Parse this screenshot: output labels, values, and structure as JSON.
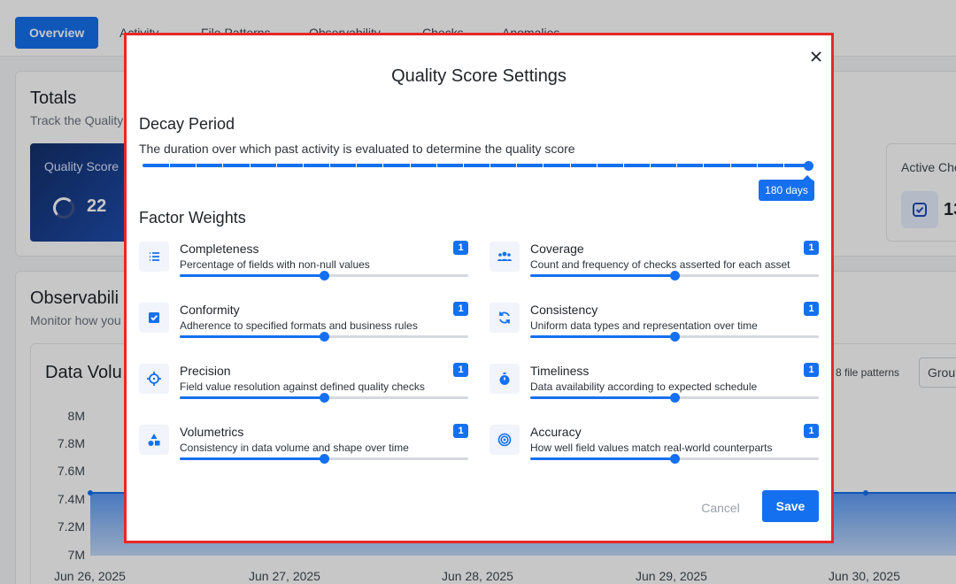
{
  "background": {
    "tabs": [
      {
        "label": "Overview",
        "active": true
      },
      {
        "label": "Activity"
      },
      {
        "label": "File Patterns"
      },
      {
        "label": "Observability"
      },
      {
        "label": "Checks"
      },
      {
        "label": "Anomalies"
      }
    ],
    "totals": {
      "title": "Totals",
      "subtitle": "Track the Quality",
      "quality_score_label": "Quality Score",
      "quality_score_value": "22",
      "active_checks_label": "Active Che",
      "active_checks_value": "13"
    },
    "observability": {
      "title": "Observabili",
      "subtitle": "Monitor how you"
    },
    "data_volume": {
      "title": "Data Volu",
      "file_patterns": "8 file patterns",
      "group_button": "Grou"
    },
    "chart_data": {
      "type": "area",
      "y_ticks": [
        "8M",
        "7.8M",
        "7.6M",
        "7.4M",
        "7.2M",
        "7M"
      ],
      "x_ticks": [
        "Jun 26, 2025",
        "Jun 27, 2025",
        "Jun 28, 2025",
        "Jun 29, 2025",
        "Jun 30, 2025"
      ],
      "ylim": [
        7000000,
        8000000
      ],
      "x": [
        "Jun 26, 2025",
        "Jun 30, 2025"
      ],
      "values": [
        7400000,
        7400000
      ]
    }
  },
  "modal": {
    "title": "Quality Score Settings",
    "decay": {
      "title": "Decay Period",
      "description": "The duration over which past activity is evaluated to determine the quality score",
      "value_label": "180 days",
      "ticks": 25,
      "fraction": 1.0
    },
    "weights_title": "Factor Weights",
    "factors": [
      {
        "key": "completeness",
        "name": "Completeness",
        "desc": "Percentage of fields with non-null values",
        "value": "1",
        "fraction": 0.5,
        "icon": "list-icon"
      },
      {
        "key": "coverage",
        "name": "Coverage",
        "desc": "Count and frequency of checks asserted for each asset",
        "value": "1",
        "fraction": 0.5,
        "icon": "users-icon"
      },
      {
        "key": "conformity",
        "name": "Conformity",
        "desc": "Adherence to specified formats and business rules",
        "value": "1",
        "fraction": 0.5,
        "icon": "checkbox-icon"
      },
      {
        "key": "consistency",
        "name": "Consistency",
        "desc": "Uniform data types and representation over time",
        "value": "1",
        "fraction": 0.5,
        "icon": "sync-icon"
      },
      {
        "key": "precision",
        "name": "Precision",
        "desc": "Field value resolution against defined quality checks",
        "value": "1",
        "fraction": 0.5,
        "icon": "crosshair-icon"
      },
      {
        "key": "timeliness",
        "name": "Timeliness",
        "desc": "Data availability according to expected schedule",
        "value": "1",
        "fraction": 0.5,
        "icon": "stopwatch-icon"
      },
      {
        "key": "volumetrics",
        "name": "Volumetrics",
        "desc": "Consistency in data volume and shape over time",
        "value": "1",
        "fraction": 0.5,
        "icon": "shapes-icon"
      },
      {
        "key": "accuracy",
        "name": "Accuracy",
        "desc": "How well field values match real-world counterparts",
        "value": "1",
        "fraction": 0.5,
        "icon": "target-icon"
      }
    ],
    "cancel_label": "Cancel",
    "save_label": "Save",
    "accent_color": "#1570ef",
    "highlight_border_color": "#e82828"
  }
}
